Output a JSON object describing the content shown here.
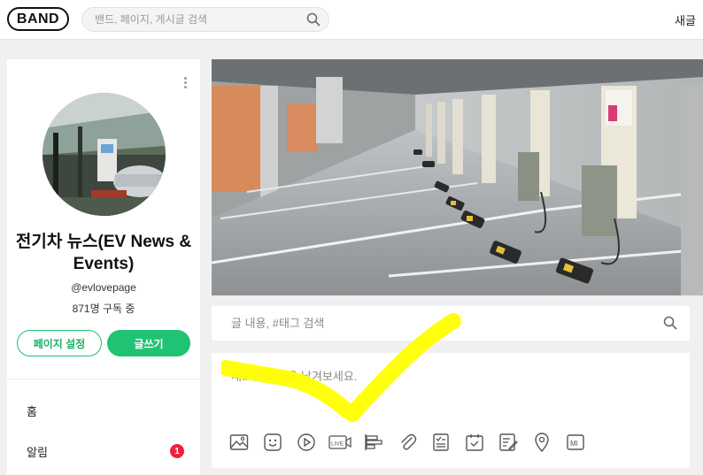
{
  "header": {
    "logo_text": "BAND",
    "search_placeholder": "밴드, 페이지, 게시글 검색",
    "right_link": "새글"
  },
  "page": {
    "name": "전기차 뉴스(EV News & Events)",
    "handle": "@evlovepage",
    "subscribers": "871명 구독 중",
    "settings_button": "페이지 설정",
    "write_button": "글쓰기"
  },
  "nav": {
    "items": [
      {
        "label": "홈"
      },
      {
        "label": "알림",
        "badge": "1"
      }
    ]
  },
  "post_search": {
    "placeholder": "글 내용, #태그 검색"
  },
  "composer": {
    "placeholder": "새로운 소식을 남겨보세요.",
    "tools": [
      "image-icon",
      "sticker-icon",
      "video-icon",
      "live-icon",
      "poll-icon",
      "attachment-icon",
      "todo-icon",
      "schedule-icon",
      "quiz-icon",
      "location-icon",
      "markdown-icon"
    ],
    "live_label": "LIVE",
    "md_label": "Ml"
  },
  "colors": {
    "brand_green": "#20c374",
    "badge_red": "#f0203d",
    "annotation_yellow": "#ffff00"
  }
}
